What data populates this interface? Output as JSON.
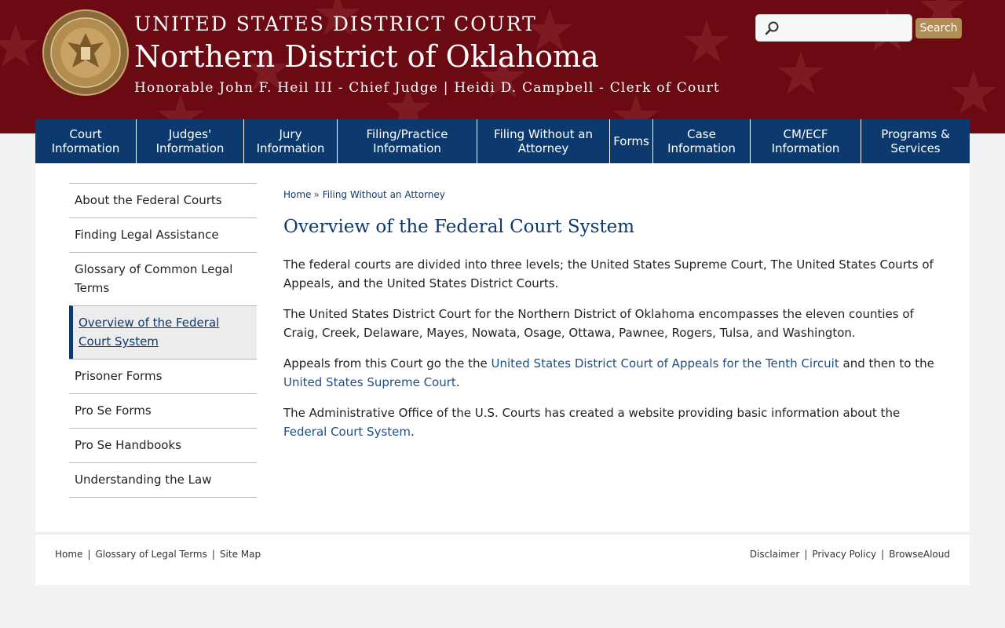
{
  "header": {
    "title_top": "UNITED STATES DISTRICT COURT",
    "title_main": "Northern District of Oklahoma",
    "title_sub": "Honorable John F. Heil III - Chief Judge | Heidi D. Campbell - Clerk of Court",
    "seal_icon": "court-seal-icon",
    "search": {
      "placeholder": "",
      "value": "",
      "button_label": "Search"
    }
  },
  "nav": [
    "Court Information",
    "Judges' Information",
    "Jury Information",
    "Filing/Practice Information",
    "Filing Without an Attorney",
    "Forms",
    "Case Information",
    "CM/ECF Information",
    "Programs & Services"
  ],
  "sidebar": {
    "items": [
      "About the Federal Courts",
      "Finding Legal Assistance",
      "Glossary of Common Legal Terms",
      "Overview of the Federal Court System",
      "Prisoner Forms",
      "Pro Se Forms",
      "Pro Se Handbooks",
      "Understanding the Law"
    ],
    "active_index": 3
  },
  "breadcrumb": {
    "home": "Home",
    "sep": "»",
    "current": "Filing Without an Attorney"
  },
  "page_title": "Overview of the Federal Court System",
  "paragraphs": {
    "p1": "The federal courts are divided into three levels; the United States Supreme Court, The United States Courts of Appeals, and the United States District Courts.",
    "p2": "The United States District Court for the Northern District of Oklahoma encompasses the eleven counties of Craig, Creek, Delaware, Mayes, Nowata, Osage, Ottawa, Pawnee, Rogers, Tulsa, and Washington.",
    "p3_a": "Appeals from this Court go the the ",
    "p3_link1": "United States District Court of Appeals for the Tenth Circuit",
    "p3_b": " and then to the ",
    "p3_link2": "United States Supreme Court",
    "p3_c": ".",
    "p4_a": "The Administrative Office of the U.S. Courts has created a website providing basic information about the ",
    "p4_link": "Federal Court System",
    "p4_b": "."
  },
  "footer": {
    "left": [
      "Home",
      "Glossary of Legal Terms",
      "Site Map"
    ],
    "right": [
      "Disclaimer",
      "Privacy Policy",
      "BrowseAloud"
    ],
    "sep": "|"
  },
  "colors": {
    "header_bg": "#6b0a12",
    "nav_bg": "#0d3a6e",
    "search_button": "#b08d57",
    "link": "#1f4f82"
  }
}
